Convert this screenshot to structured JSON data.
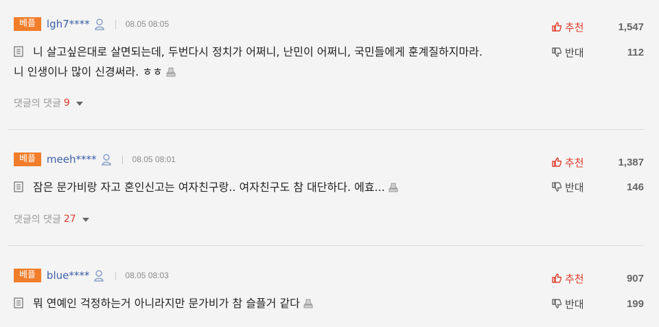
{
  "comments": [
    {
      "badge": "베플",
      "username": "lgh7****",
      "divider": "|",
      "timestamp": "08.05 08:05",
      "text_line1": "니 살고싶은대로 살면되는데, 두번다시 정치가 어쩌니, 난민이 어쩌니, 국민들에게 훈계질하지마라.",
      "text_line2": "니 인생이나 많이 신경써라. ㅎㅎ",
      "replies_label": "댓글의 댓글",
      "replies_count": "9",
      "upvote_label": "추천",
      "upvote_count": "1,547",
      "downvote_label": "반대",
      "downvote_count": "112"
    },
    {
      "badge": "베플",
      "username": "meeh****",
      "divider": "|",
      "timestamp": "08.05 08:01",
      "text_line1": "잠은 문가비랑 자고 혼인신고는 여자친구랑.. 여자친구도 참 대단하다. 에효...",
      "replies_label": "댓글의 댓글",
      "replies_count": "27",
      "upvote_label": "추천",
      "upvote_count": "1,387",
      "downvote_label": "반대",
      "downvote_count": "146"
    },
    {
      "badge": "베플",
      "username": "blue****",
      "divider": "|",
      "timestamp": "08.05 08:03",
      "text_line1": "뭐 연예인 걱정하는거 아니라지만 문가비가 참 슬플거 같다",
      "upvote_label": "추천",
      "upvote_count": "907",
      "downvote_label": "반대",
      "downvote_count": "199"
    }
  ],
  "colors": {
    "badge": "#f07d2a",
    "username": "#3b5ea8",
    "upvote": "#e03b2b",
    "reply_count": "#e03b2b",
    "background": "#f4f4f4"
  },
  "icons": {
    "user": "person-icon",
    "document": "document-icon",
    "stamp": "report-stamp-icon",
    "thumbs_up": "thumbs-up-icon",
    "thumbs_down": "thumbs-down-icon",
    "dropdown": "caret-down-icon"
  }
}
